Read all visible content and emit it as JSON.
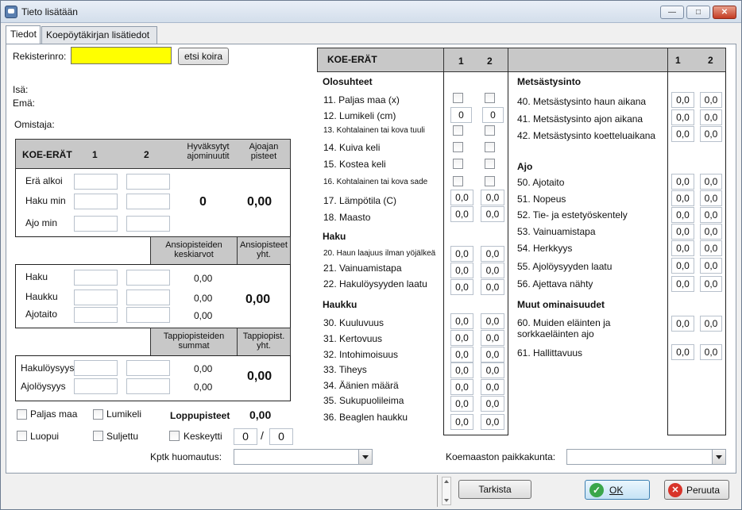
{
  "window": {
    "title": "Tieto lisätään",
    "min": "—",
    "max": "□",
    "close": "✕"
  },
  "tabs": [
    "Tiedot",
    "Koepöytäkirjan lisätiedot"
  ],
  "left": {
    "rekisterinro_label": "Rekisterinro:",
    "etsi_button": "etsi koira",
    "isa_label": "Isä:",
    "ema_label": "Emä:",
    "omistaja_label": "Omistaja:",
    "koe_erat": "KOE-ERÄT",
    "col1": "1",
    "col2": "2",
    "hyvaksytyt": "Hyväksytyt ajominuutit",
    "ajoajan_pisteet": "Ajoajan pisteet",
    "era_alkoi": "Erä alkoi",
    "haku_min": "Haku min",
    "ajo_min": "Ajo min",
    "minutes_value": "0",
    "ajoajan_value": "0,00",
    "ansio_keskiarvot": "Ansiopisteiden keskiarvot",
    "ansio_yht": "Ansiopisteet yht.",
    "ansio_rows": [
      {
        "label": "Haku",
        "value": "0,00"
      },
      {
        "label": "Haukku",
        "value": "0,00"
      },
      {
        "label": "Ajotaito",
        "value": "0,00"
      }
    ],
    "ansio_total": "0,00",
    "tappio_summat": "Tappiopisteiden summat",
    "tappio_yht": "Tappiopist. yht.",
    "tappio_rows": [
      {
        "label": "Hakulöysyys",
        "value": "0,00"
      },
      {
        "label": "Ajolöysyys",
        "value": "0,00"
      }
    ],
    "tappio_total": "0,00",
    "checks": [
      "Paljas maa",
      "Lumikeli",
      "Luopui",
      "Suljettu",
      "Keskeytti"
    ],
    "loppupisteet_label": "Loppupisteet",
    "loppupisteet_value": "0,00",
    "kesk_a": "0",
    "kesk_sep": "/",
    "kesk_b": "0",
    "kptk_label": "Kptk huomautus:"
  },
  "mid": {
    "koe_erat": "KOE-ERÄT",
    "col1": "1",
    "col2": "2",
    "olosuhteet": "Olosuhteet",
    "rows": [
      {
        "label": "11. Paljas maa (x)",
        "type": "check"
      },
      {
        "label": "12. Lumikeli (cm)",
        "v1": "0",
        "v2": "0"
      },
      {
        "label": "13. Kohtalainen tai kova tuuli",
        "type": "check",
        "small": true
      },
      {
        "label": "14. Kuiva keli",
        "type": "check"
      },
      {
        "label": "15. Kostea keli",
        "type": "check"
      },
      {
        "label": "16. Kohtalainen tai kova sade",
        "type": "check",
        "small": true
      },
      {
        "label": "17. Lämpötila (C)",
        "v1": "0,0",
        "v2": "0,0"
      },
      {
        "label": "18. Maasto",
        "v1": "0,0",
        "v2": "0,0"
      }
    ],
    "haku": "Haku",
    "haku_rows": [
      {
        "label": "20. Haun laajuus ilman yöjälkeä",
        "v1": "0,0",
        "v2": "0,0",
        "small": true
      },
      {
        "label": "21. Vainuamistapa",
        "v1": "0,0",
        "v2": "0,0"
      },
      {
        "label": "22. Hakulöysyyden laatu",
        "v1": "0,0",
        "v2": "0,0"
      }
    ],
    "haukku": "Haukku",
    "haukku_rows": [
      {
        "label": "30. Kuuluvuus",
        "v1": "0,0",
        "v2": "0,0"
      },
      {
        "label": "31. Kertovuus",
        "v1": "0,0",
        "v2": "0,0"
      },
      {
        "label": "32. Intohimoisuus",
        "v1": "0,0",
        "v2": "0,0"
      },
      {
        "label": "33. Tiheys",
        "v1": "0,0",
        "v2": "0,0"
      },
      {
        "label": "34. Äänien määrä",
        "v1": "0,0",
        "v2": "0,0"
      },
      {
        "label": "35. Sukupuolileima",
        "v1": "0,0",
        "v2": "0,0"
      },
      {
        "label": "36. Beaglen haukku",
        "v1": "0,0",
        "v2": "0,0"
      }
    ]
  },
  "right": {
    "col1": "1",
    "col2": "2",
    "metsastysinto": "Metsästysinto",
    "mets_rows": [
      {
        "label": "40. Metsästysinto haun aikana",
        "v1": "0,0",
        "v2": "0,0"
      },
      {
        "label": "41. Metsästysinto ajon aikana",
        "v1": "0,0",
        "v2": "0,0"
      },
      {
        "label": "42. Metsästysinto koetteluaikana",
        "v1": "0,0",
        "v2": "0,0"
      }
    ],
    "ajo": "Ajo",
    "ajo_rows": [
      {
        "label": "50. Ajotaito",
        "v1": "0,0",
        "v2": "0,0"
      },
      {
        "label": "51. Nopeus",
        "v1": "0,0",
        "v2": "0,0"
      },
      {
        "label": "52. Tie- ja estetyöskentely",
        "v1": "0,0",
        "v2": "0,0"
      },
      {
        "label": "53. Vainuamistapa",
        "v1": "0,0",
        "v2": "0,0"
      },
      {
        "label": "54. Herkkyys",
        "v1": "0,0",
        "v2": "0,0"
      },
      {
        "label": "55. Ajolöysyyden laatu",
        "v1": "0,0",
        "v2": "0,0"
      },
      {
        "label": "56. Ajettava nähty",
        "v1": "0,0",
        "v2": "0,0"
      }
    ],
    "muut": "Muut ominaisuudet",
    "muut_rows": [
      {
        "label": "60. Muiden eläinten ja sorkkaeläinten ajo",
        "v1": "0,0",
        "v2": "0,0"
      },
      {
        "label": "61. Hallittavuus",
        "v1": "0,0",
        "v2": "0,0"
      }
    ],
    "koemaasto_label": "Koemaaston paikkakunta:"
  },
  "bottom": {
    "tarkista": "Tarkista",
    "ok": "OK",
    "peruuta": "Peruuta"
  },
  "colors": {
    "accent": "#ffff00",
    "header_gray": "#c8c8c8"
  }
}
